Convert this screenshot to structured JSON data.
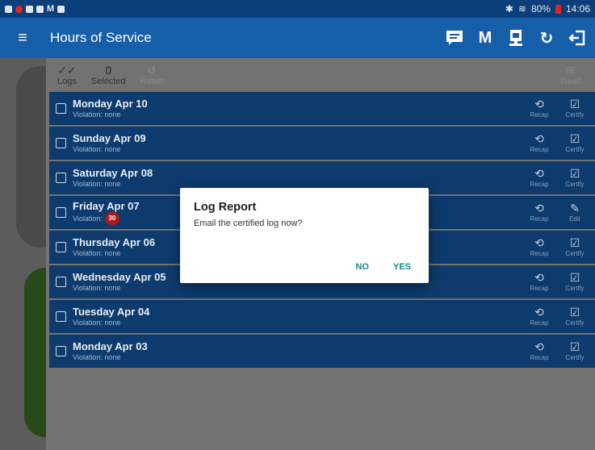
{
  "status": {
    "left_text": "M",
    "right_text": "80%",
    "time": "14:06"
  },
  "appbar": {
    "title": "Hours of Service",
    "actions": [
      "message-icon",
      "M",
      "upload-icon",
      "refresh-icon",
      "logout-icon"
    ],
    "m_label": "M"
  },
  "toolbar": {
    "logs_label": "Logs",
    "selected_count": "0",
    "selected_label": "Selected",
    "reset_label": "Reset",
    "email_label": "Email"
  },
  "logs": [
    {
      "day": "Monday Apr 10",
      "violation": "Violation: none",
      "action": "Certify"
    },
    {
      "day": "Sunday Apr 09",
      "violation": "Violation: none",
      "action": "Certify"
    },
    {
      "day": "Saturday Apr 08",
      "violation": "Violation: none",
      "action": "Certify"
    },
    {
      "day": "Friday Apr 07",
      "violation": "Violation:",
      "badge": "30",
      "action": "Edit"
    },
    {
      "day": "Thursday Apr 06",
      "violation": "Violation: none",
      "action": "Certify"
    },
    {
      "day": "Wednesday Apr 05",
      "violation": "Violation: none",
      "action": "Certify"
    },
    {
      "day": "Tuesday Apr 04",
      "violation": "Violation: none",
      "action": "Certify"
    },
    {
      "day": "Monday Apr 03",
      "violation": "Violation: none",
      "action": "Certify"
    }
  ],
  "recap_label": "Recap",
  "dialog": {
    "title": "Log Report",
    "message": "Email the certified log now?",
    "no_label": "NO",
    "yes_label": "YES"
  },
  "colors": {
    "appbar": "#175ea9",
    "statusbar": "#0c3f7a",
    "row": "#0d3b6e",
    "dialog_button": "#138a8a",
    "badge": "#b01717"
  }
}
